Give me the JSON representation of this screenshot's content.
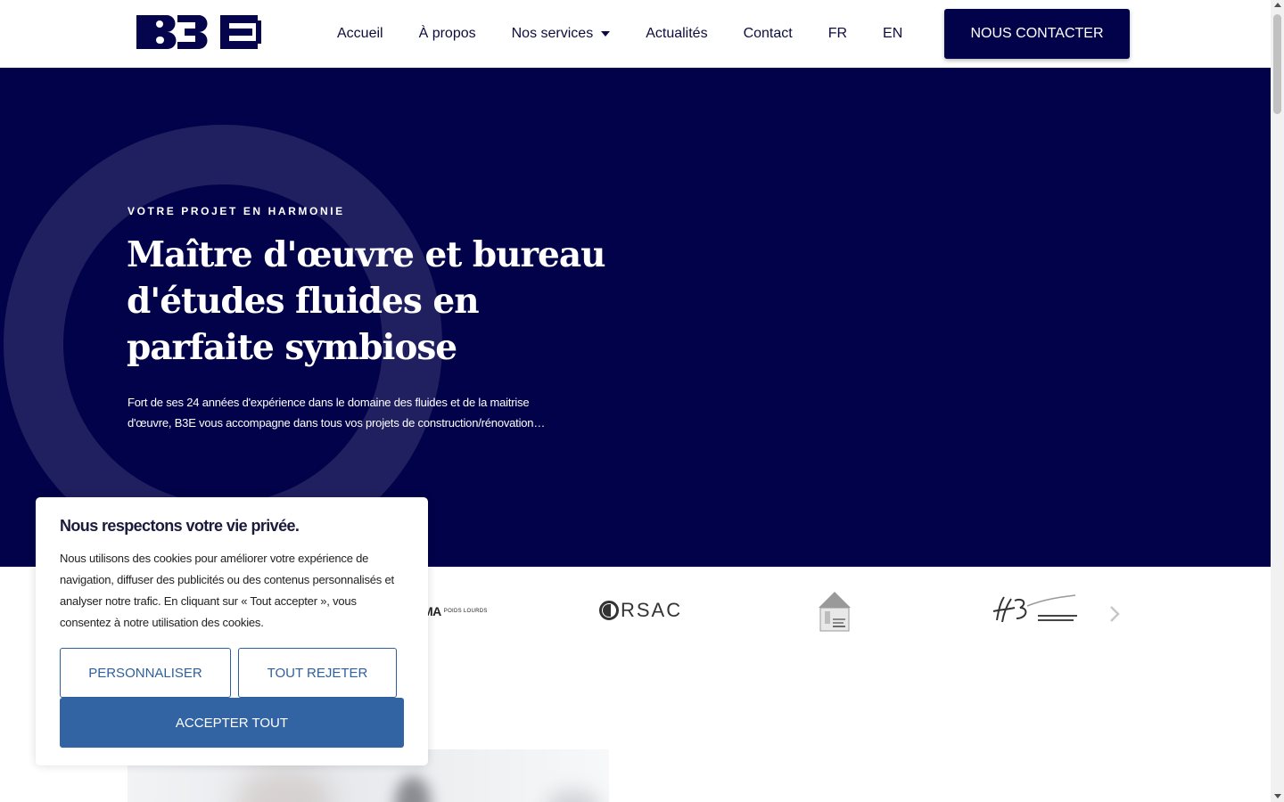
{
  "header": {
    "logo_alt": "B3E",
    "nav": [
      {
        "label": "Accueil"
      },
      {
        "label": "À propos"
      },
      {
        "label": "Nos services",
        "has_dropdown": true
      },
      {
        "label": "Actualités"
      },
      {
        "label": "Contact"
      },
      {
        "label": "FR"
      },
      {
        "label": "EN"
      }
    ],
    "cta_label": "NOUS CONTACTER"
  },
  "hero": {
    "eyebrow": "VOTRE PROJET EN HARMONIE",
    "title": "Maître d'œuvre et bureau d'études fluides en parfaite symbiose",
    "description": "Fort de ses 24 années d'expérience dans le domaine des fluides et de la maitrise d'œuvre, B3E vous accompagne dans tous vos projets de construction/rénovation…"
  },
  "partners": {
    "brands": [
      {
        "name": "MA",
        "tagline": "POIDS LOURDS"
      },
      {
        "name": "RSAC"
      }
    ],
    "next_icon": "chevron-right-icon"
  },
  "cookie": {
    "title": "Nous respectons votre vie privée.",
    "text": "Nous utilisons des cookies pour améliorer votre expérience de navigation, diffuser des publicités ou des contenus personnalisés et analyser notre trafic. En cliquant sur « Tout accepter », vous consentez à notre utilisation des cookies.",
    "customize_label": "PERSONNALISER",
    "reject_label": "TOUT REJETER",
    "accept_label": "ACCEPTER TOUT"
  },
  "colors": {
    "brand_navy": "#02024a",
    "cookie_blue": "#3264a4",
    "white": "#ffffff"
  }
}
